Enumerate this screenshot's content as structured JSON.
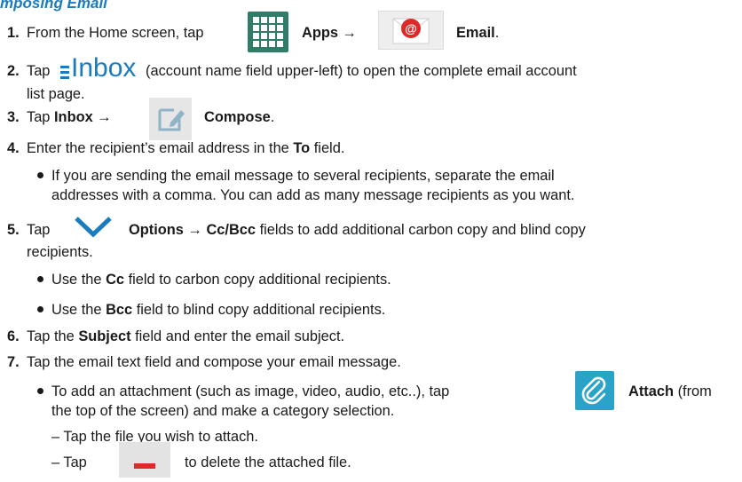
{
  "heading": "mposing Email",
  "steps": {
    "s1": {
      "num": "1.",
      "a": "From the Home screen, tap",
      "apps": "Apps",
      "arrow": "→",
      "email": "Email",
      "end": "."
    },
    "s2": {
      "num": "2.",
      "a": "Tap",
      "inbox_label": "Inbox",
      "b": "(account name field upper-left) to open the complete email account",
      "c": "list page."
    },
    "s3": {
      "num": "3.",
      "a": "Tap",
      "inbox": "Inbox",
      "arrow": "→",
      "compose": "Compose",
      "end": "."
    },
    "s4": {
      "num": "4.",
      "a": "Enter the recipient’s email address in the",
      "to": "To",
      "end": "field.",
      "bullet": "If you are sending the email message to several recipients, separate the email",
      "bullet2": "addresses with a comma. You can add as many message recipients as you want."
    },
    "s5": {
      "num": "5.",
      "a": "Tap",
      "options": "Options",
      "arrow": "→",
      "ccbcc": "Cc/Bcc",
      "b": "fields to add additional carbon copy and blind copy",
      "c": "recipients.",
      "bullet1_a": "Use the",
      "bullet1_cc": "Cc",
      "bullet1_b": "field to carbon copy additional recipients.",
      "bullet2_a": "Use the",
      "bullet2_bcc": "Bcc",
      "bullet2_b": "field to blind copy additional recipients."
    },
    "s6": {
      "num": "6.",
      "a": "Tap the",
      "subject": "Subject",
      "b": "field and enter the email subject."
    },
    "s7": {
      "num": "7.",
      "a": "Tap the email text field and compose your email message.",
      "bullet_a": "To add an attachment (such as image, video, audio, etc..), tap",
      "attach": "Attach",
      "bullet_b": "(from",
      "bullet_c": "the top of the screen) and make a category selection.",
      "dash1": "–  Tap the file you wish to attach.",
      "dash2_a": "–  Tap",
      "dash2_b": "to delete the attached file."
    }
  },
  "colors": {
    "accent": "#1b7bbf",
    "attach_bg": "#2aa3c9",
    "delete_red": "#e02828",
    "apps_green": "#2f7d66"
  }
}
